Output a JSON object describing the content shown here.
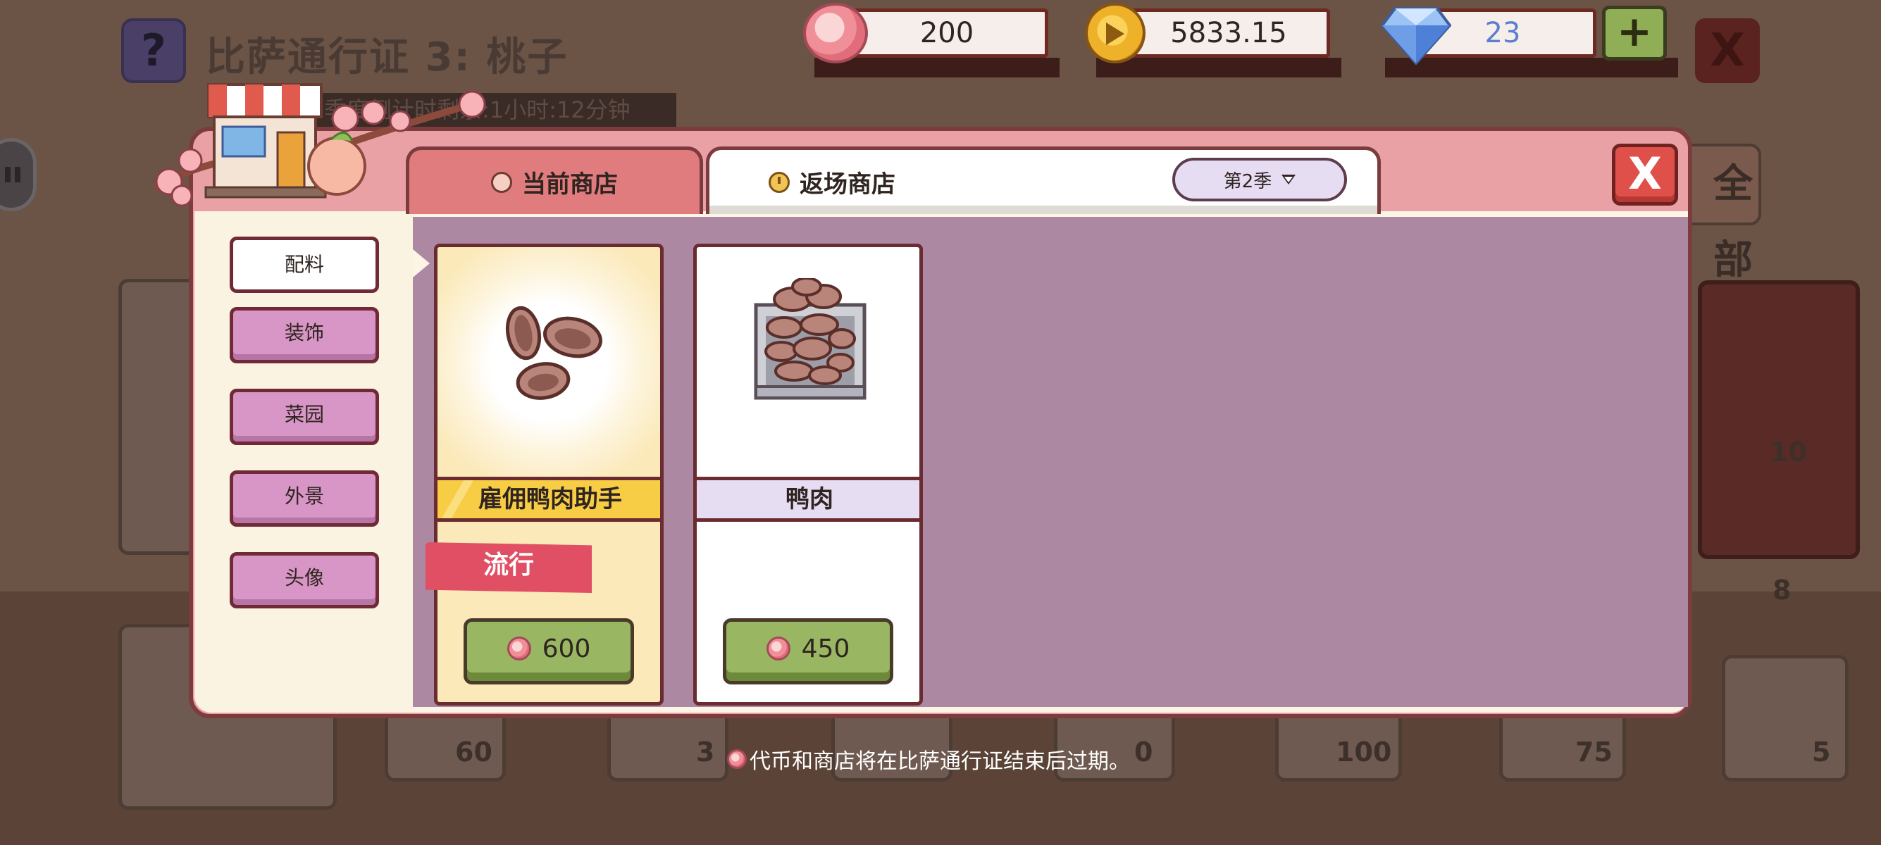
{
  "background": {
    "title": "比萨通行证 3: 桃子",
    "help_icon": "?",
    "timer_text": "季度倒计时剩余:1小时:12分钟",
    "right_button_text": "全部",
    "close_icon": "X",
    "card_counts": [
      "60",
      "3",
      "0",
      "100",
      "75",
      "5"
    ],
    "side_counts": [
      "10",
      "8"
    ]
  },
  "currencies": {
    "peach_coins": "200",
    "gold_coins": "5833.15",
    "gems": "23",
    "add_label": "+",
    "colors": {
      "peach": "#e26d7a",
      "gold": "#eeb12a",
      "gem": "#5b8fe0"
    }
  },
  "shop": {
    "tabs": [
      {
        "label": "当前商店",
        "icon": "peach-icon",
        "active": true
      },
      {
        "label": "返场商店",
        "icon": "clock-icon",
        "active": false
      }
    ],
    "season_select": "第2季",
    "close_label": "X",
    "categories": [
      {
        "label": "配料",
        "active": true
      },
      {
        "label": "装饰",
        "active": false
      },
      {
        "label": "菜园",
        "active": false
      },
      {
        "label": "外景",
        "active": false
      },
      {
        "label": "头像",
        "active": false
      }
    ],
    "items": [
      {
        "name": "雇佣鸭肉助手",
        "badge": "流行",
        "price": "600",
        "icon": "duck-slices-icon"
      },
      {
        "name": "鸭肉",
        "badge": "",
        "price": "450",
        "icon": "duck-crate-icon"
      }
    ],
    "footer_note": "代币和商店将在比萨通行证结束后过期。"
  }
}
